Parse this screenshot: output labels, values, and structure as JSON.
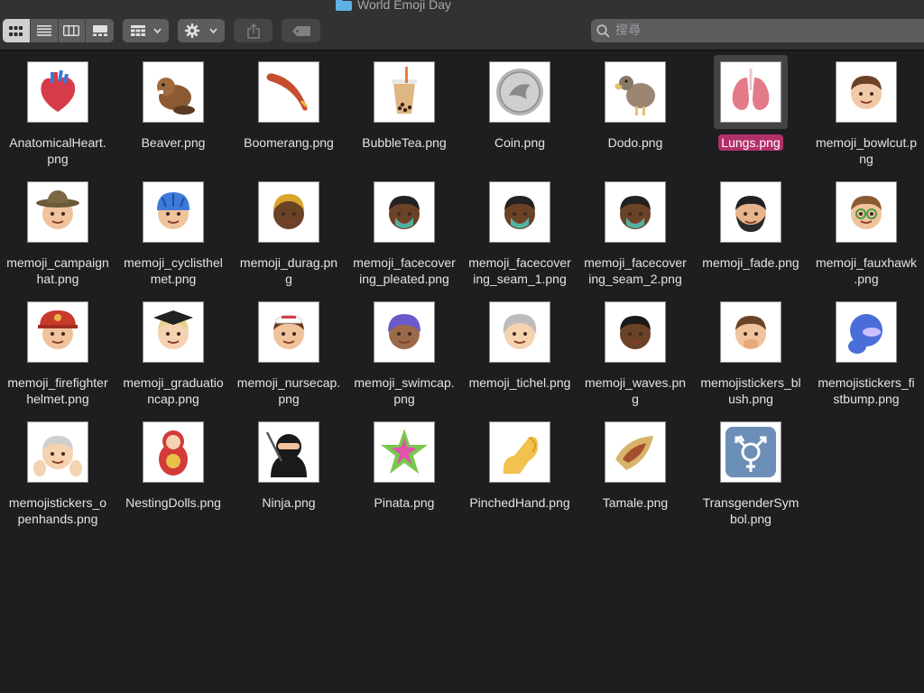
{
  "window": {
    "title": "World Emoji Day"
  },
  "toolbar": {
    "view_buttons": [
      {
        "name": "icon-view",
        "active": true
      },
      {
        "name": "list-view",
        "active": false
      },
      {
        "name": "column-view",
        "active": false
      },
      {
        "name": "gallery-view",
        "active": false
      }
    ],
    "search_placeholder": "搜尋"
  },
  "files": [
    {
      "name": "AnatomicalHeart.png",
      "label": "AnatomicalHeart.\npng",
      "icon": "anatomical-heart"
    },
    {
      "name": "Beaver.png",
      "label": "Beaver.png",
      "icon": "beaver"
    },
    {
      "name": "Boomerang.png",
      "label": "Boomerang.png",
      "icon": "boomerang"
    },
    {
      "name": "BubbleTea.png",
      "label": "BubbleTea.png",
      "icon": "bubble-tea"
    },
    {
      "name": "Coin.png",
      "label": "Coin.png",
      "icon": "coin"
    },
    {
      "name": "Dodo.png",
      "label": "Dodo.png",
      "icon": "dodo"
    },
    {
      "name": "Lungs.png",
      "label": "Lungs.png",
      "icon": "lungs",
      "selected": true
    },
    {
      "name": "memoji_bowlcut.png",
      "label": "memoji_bowlcut.p\nng",
      "icon": "memoji"
    },
    {
      "name": "memoji_campaignhat.png",
      "label": "memoji_campaign\nhat.png",
      "icon": "memoji-hat"
    },
    {
      "name": "memoji_cyclisthelmet.png",
      "label": "memoji_cyclisthel\nmet.png",
      "icon": "memoji-helmet"
    },
    {
      "name": "memoji_durag.png",
      "label": "memoji_durag.pn\ng",
      "icon": "memoji-durag"
    },
    {
      "name": "memoji_facecovering_pleated.png",
      "label": "memoji_facecover\ning_pleated.png",
      "icon": "memoji-mask"
    },
    {
      "name": "memoji_facecovering_seam_1.png",
      "label": "memoji_facecover\ning_seam_1.png",
      "icon": "memoji-mask"
    },
    {
      "name": "memoji_facecovering_seam_2.png",
      "label": "memoji_facecover\ning_seam_2.png",
      "icon": "memoji-mask"
    },
    {
      "name": "memoji_fade.png",
      "label": "memoji_fade.png",
      "icon": "memoji-beard"
    },
    {
      "name": "memoji_fauxhawk.png",
      "label": "memoji_fauxhawk\n.png",
      "icon": "memoji-glasses"
    },
    {
      "name": "memoji_firefighterhelmet.png",
      "label": "memoji_firefighter\nhelmet.png",
      "icon": "memoji-firefighter"
    },
    {
      "name": "memoji_graduationcap.png",
      "label": "memoji_graduatio\nncap.png",
      "icon": "memoji-grad"
    },
    {
      "name": "memoji_nursecap.png",
      "label": "memoji_nursecap.\npng",
      "icon": "memoji-nurse"
    },
    {
      "name": "memoji_swimcap.png",
      "label": "memoji_swimcap.\npng",
      "icon": "memoji-swimcap"
    },
    {
      "name": "memoji_tichel.png",
      "label": "memoji_tichel.png",
      "icon": "memoji-tichel"
    },
    {
      "name": "memoji_waves.png",
      "label": "memoji_waves.pn\ng",
      "icon": "memoji-dark"
    },
    {
      "name": "memojistickers_blush.png",
      "label": "memojistickers_bl\nush.png",
      "icon": "memoji-blush"
    },
    {
      "name": "memojistickers_fistbump.png",
      "label": "memojistickers_fi\nstbump.png",
      "icon": "memoji-fistbump"
    },
    {
      "name": "memojistickers_openhands.png",
      "label": "memojistickers_o\npenhands.png",
      "icon": "memoji-openhands"
    },
    {
      "name": "NestingDolls.png",
      "label": "NestingDolls.png",
      "icon": "nesting-dolls"
    },
    {
      "name": "Ninja.png",
      "label": "Ninja.png",
      "icon": "ninja"
    },
    {
      "name": "Pinata.png",
      "label": "Pinata.png",
      "icon": "pinata"
    },
    {
      "name": "PinchedHand.png",
      "label": "PinchedHand.png",
      "icon": "pinched-hand"
    },
    {
      "name": "Tamale.png",
      "label": "Tamale.png",
      "icon": "tamale"
    },
    {
      "name": "TransgenderSymbol.png",
      "label": "TransgenderSym\nbol.png",
      "icon": "transgender-symbol"
    }
  ],
  "colors": {
    "selection": "#b2306a",
    "background": "#1e1e20",
    "toolbar": "#323235"
  }
}
